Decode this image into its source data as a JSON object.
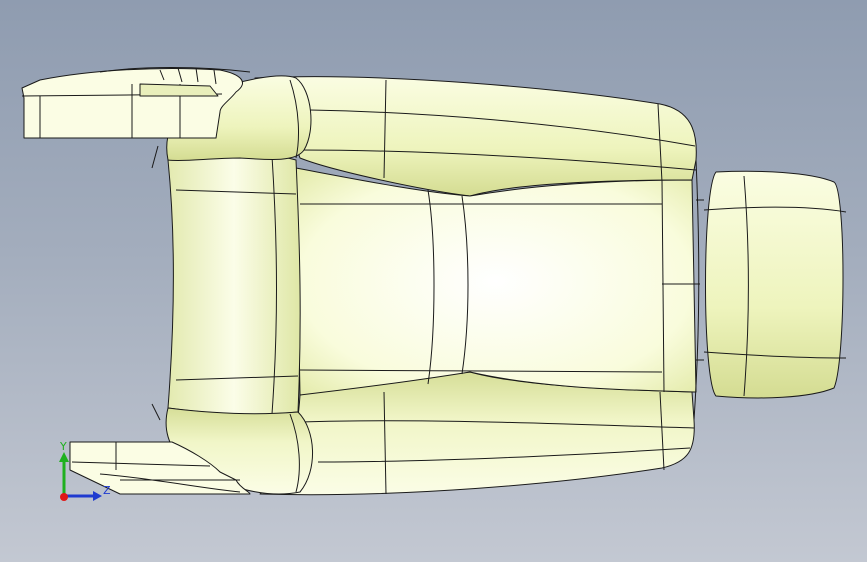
{
  "viewport": {
    "background_top": "#8f9cb0",
    "background_bottom": "#c3c8d2"
  },
  "model": {
    "fill_color": "#f6fbc9",
    "highlight_color": "#fbfde6",
    "shade_color": "#d9e29a",
    "edge_color": "#1a1a1a"
  },
  "triad": {
    "y_label": "Y",
    "z_label": "Z",
    "y_color": "#1fb01f",
    "z_color": "#1f3ad0",
    "x_color": "#e01818"
  }
}
